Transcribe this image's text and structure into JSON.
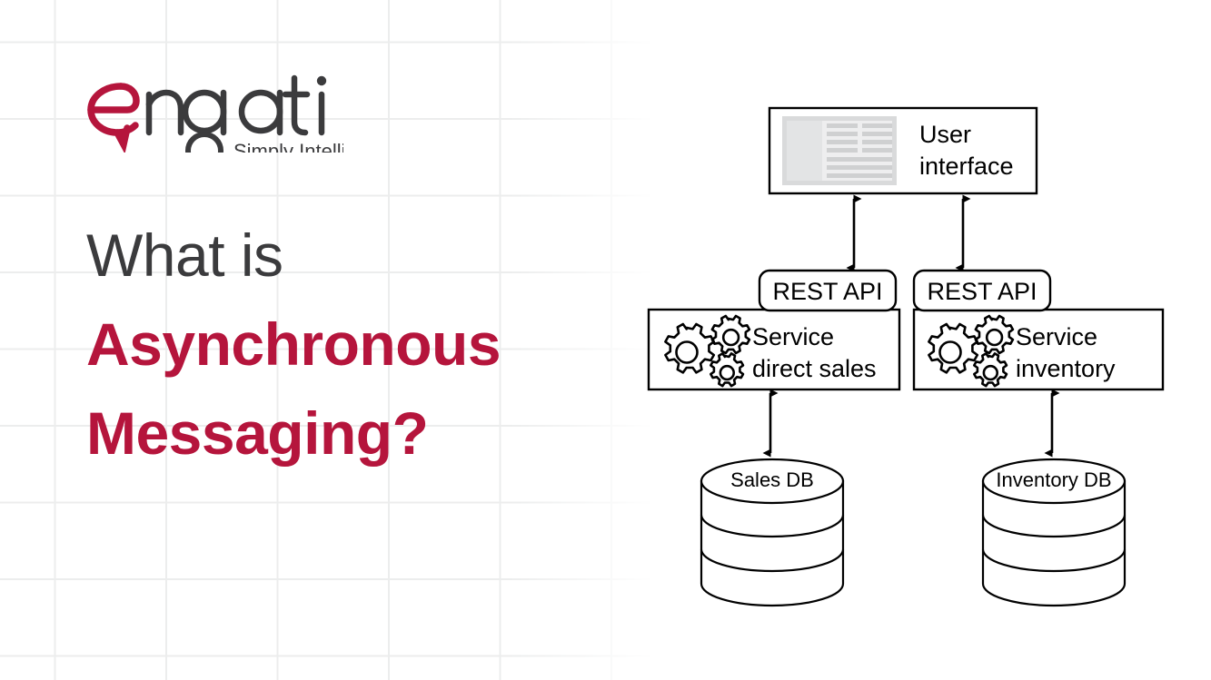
{
  "brand": {
    "name": "engati",
    "tagline": "Simply Intelligent",
    "accent_color": "#b5153c",
    "text_color": "#3b3b3d"
  },
  "headline": {
    "line1": "What is",
    "line2": "Asynchronous",
    "line3": "Messaging?"
  },
  "diagram": {
    "type": "architecture",
    "nodes": {
      "user_interface": {
        "label_line1": "User",
        "label_line2": "interface",
        "icon": "wireframe-layout-icon"
      },
      "rest_api_left": {
        "label": "REST API"
      },
      "rest_api_right": {
        "label": "REST API"
      },
      "service_sales": {
        "label_line1": "Service",
        "label_line2": "direct sales",
        "icon": "gears-icon"
      },
      "service_inventory": {
        "label_line1": "Service",
        "label_line2": "inventory",
        "icon": "gears-icon"
      },
      "sales_db": {
        "label": "Sales DB",
        "icon": "database-cylinder-icon"
      },
      "inventory_db": {
        "label": "Inventory DB",
        "icon": "database-cylinder-icon"
      }
    },
    "edges": [
      {
        "from": "user_interface",
        "to": "rest_api_left",
        "style": "double-arrow"
      },
      {
        "from": "user_interface",
        "to": "rest_api_right",
        "style": "double-arrow"
      },
      {
        "from": "service_sales",
        "to": "sales_db",
        "style": "double-arrow"
      },
      {
        "from": "service_inventory",
        "to": "inventory_db",
        "style": "double-arrow"
      }
    ],
    "stroke_color": "#000000",
    "fill_color": "#ffffff"
  }
}
